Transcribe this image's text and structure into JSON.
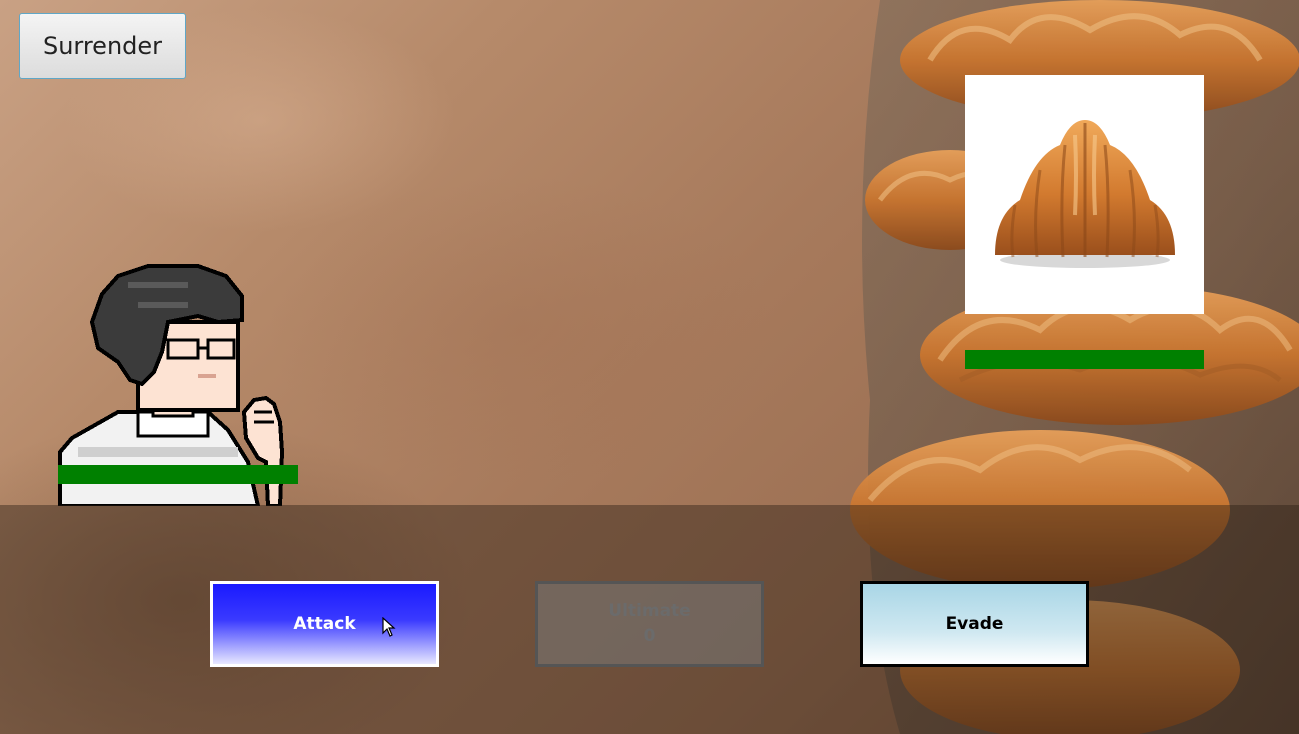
{
  "buttons": {
    "surrender": "Surrender",
    "attack": "Attack",
    "ultimate_label": "Ultimate",
    "ultimate_charge": "0",
    "evade": "Evade"
  },
  "player": {
    "hp_fraction": 1.0
  },
  "enemy": {
    "hp_fraction": 1.0
  },
  "icons": {
    "player": "pixel-art-boy-with-glasses-icon",
    "enemy": "croissant-icon",
    "cursor": "mouse-pointer-icon"
  },
  "colors": {
    "hp_bar": "#008000",
    "attack_top": "#1a1aff",
    "evade_top": "#a9d6e6",
    "ultimate_disabled": "#787878"
  }
}
